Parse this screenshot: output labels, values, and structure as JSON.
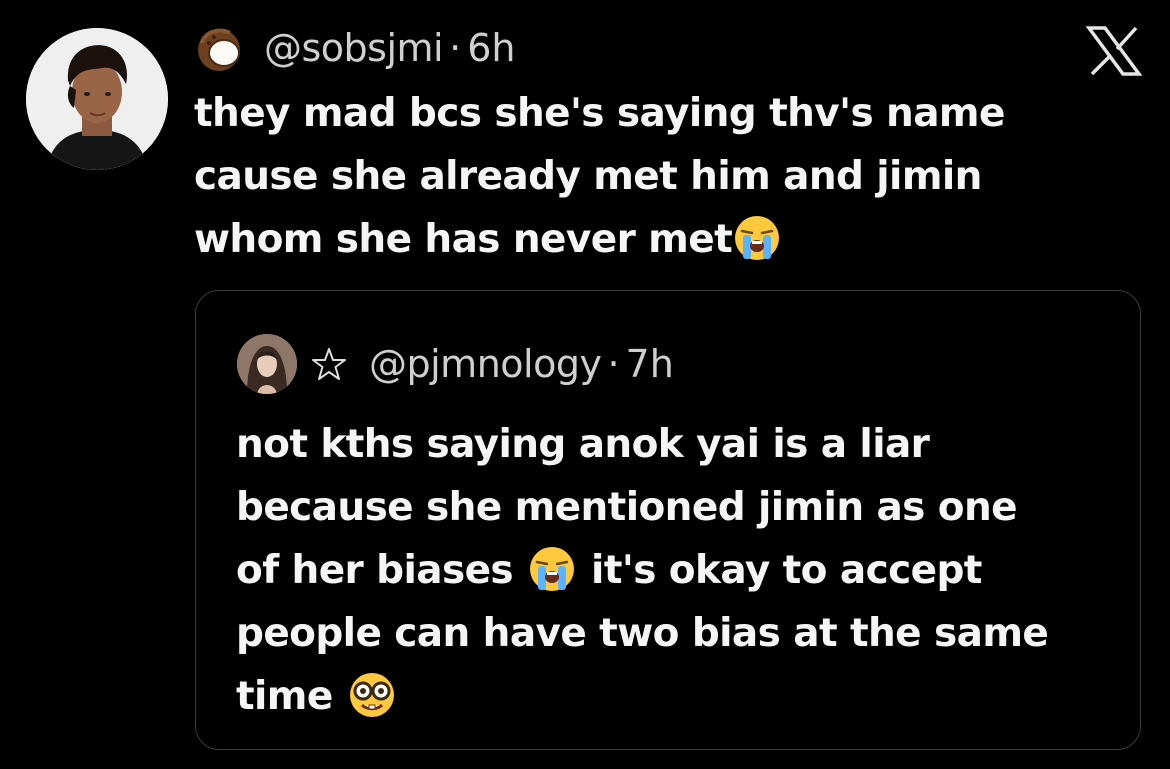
{
  "post": {
    "avatar": "profile-photo",
    "handle_icon": "coconut-emoji",
    "handle": "@sobsjmi",
    "separator": "·",
    "time": "6h",
    "text_lines": [
      "they mad bcs she's saying thv's name",
      "cause she already met him and jimin",
      "whom she has never met"
    ],
    "text_emoji": "loudly-crying-face-emoji"
  },
  "close_icon": "x-logo-icon",
  "quote": {
    "avatar": "profile-photo",
    "badge_icon": "star-outline-icon",
    "handle": "@pjmnology",
    "separator": "·",
    "time": "7h",
    "text_lines": [
      "not kths saying anok yai is a liar",
      "because she mentioned jimin as one",
      "of her biases",
      "it's okay to accept",
      "people can have two bias at the same",
      "time"
    ],
    "emojis": [
      "loudly-crying-face-emoji",
      "nerd-face-emoji"
    ]
  },
  "colors": {
    "background": "#000000",
    "text": "#f5f5f5",
    "muted_text": "#cfcfcf",
    "card_border": "#3b3b3b"
  }
}
